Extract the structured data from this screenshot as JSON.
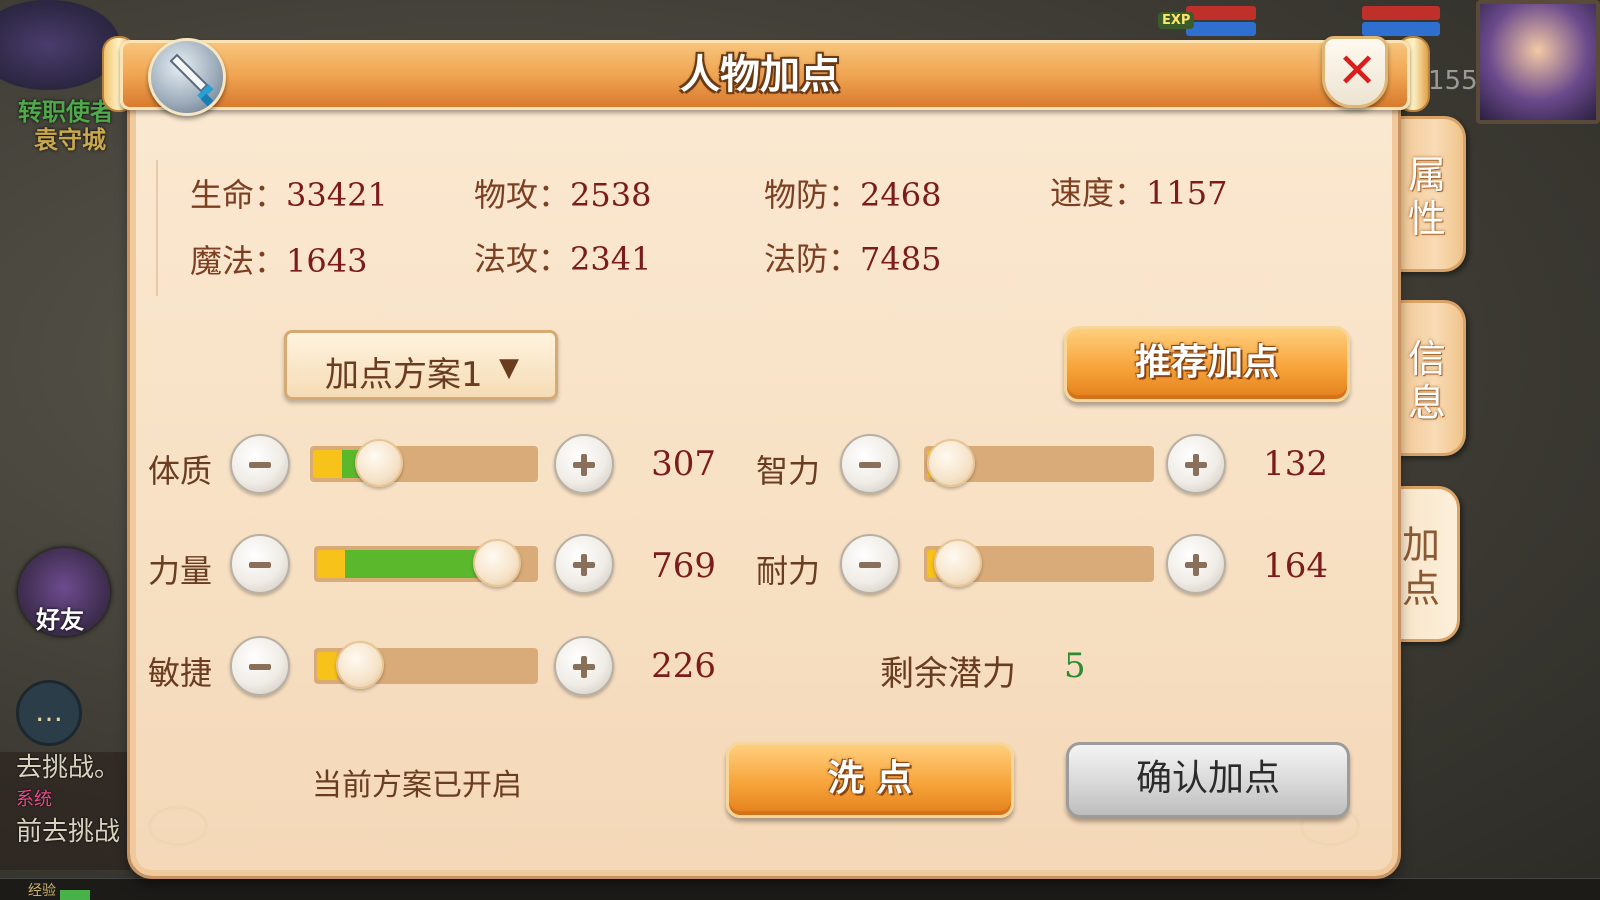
{
  "scene": {
    "npc_name": "转职使者",
    "city": "袁守城",
    "friend_label": "好友",
    "chat_lines": [
      "去挑战。",
      "系统",
      "前去挑战"
    ],
    "exp_label": "经验",
    "hud_exp": "EXP",
    "level": "155"
  },
  "dialog": {
    "title": "人物加点",
    "close_icon": "close-x-icon",
    "badge_icon": "sword-icon"
  },
  "side_tabs": [
    {
      "label": "属性",
      "active": false
    },
    {
      "label": "信息",
      "active": false
    },
    {
      "label": "加点",
      "active": true
    }
  ],
  "stats": [
    {
      "label": "生命：",
      "value": "33421"
    },
    {
      "label": "物攻：",
      "value": "2538"
    },
    {
      "label": "物防：",
      "value": "2468"
    },
    {
      "label": "速度：",
      "value": "1157"
    },
    {
      "label": "魔法：",
      "value": "1643"
    },
    {
      "label": "法攻：",
      "value": "2341"
    },
    {
      "label": "法防：",
      "value": "7485"
    }
  ],
  "plan_select": {
    "value": "加点方案1",
    "arrow": "▼"
  },
  "recommend_button": "推荐加点",
  "attributes": [
    {
      "label": "体质",
      "value": "307",
      "base_fraction": 0.13,
      "added_fraction": 0.15,
      "knob_fraction": 0.31
    },
    {
      "label": "力量",
      "value": "769",
      "base_fraction": 0.13,
      "added_fraction": 0.62,
      "knob_fraction": 0.84
    },
    {
      "label": "敏捷",
      "value": "226",
      "base_fraction": 0.09,
      "added_fraction": 0.0,
      "knob_fraction": 0.21
    },
    {
      "label": "智力",
      "value": "132",
      "base_fraction": 0.02,
      "added_fraction": 0.0,
      "knob_fraction": 0.12
    },
    {
      "label": "耐力",
      "value": "164",
      "base_fraction": 0.04,
      "added_fraction": 0.0,
      "knob_fraction": 0.15
    }
  ],
  "remaining": {
    "label": "剩余潜力",
    "value": "5"
  },
  "plan_status": "当前方案已开启",
  "reset_button": "洗  点",
  "confirm_button": "确认加点",
  "colors": {
    "accent_orange": "#f7a43b",
    "stat_value": "#7b1b1b",
    "remaining_value": "#2e8a35"
  }
}
